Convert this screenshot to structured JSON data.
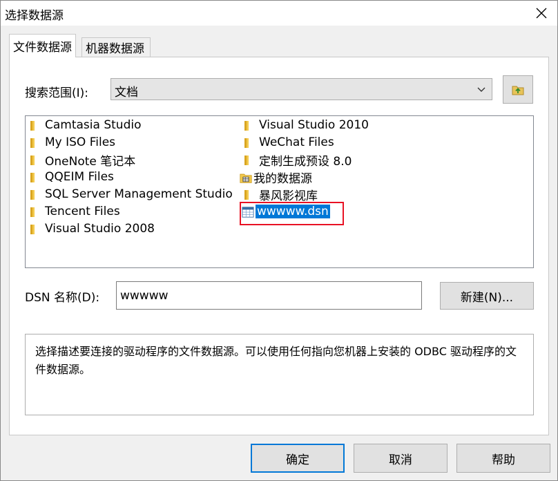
{
  "window": {
    "title": "选择数据源"
  },
  "tabs": [
    {
      "label": "文件数据源",
      "active": true
    },
    {
      "label": "机器数据源",
      "active": false
    }
  ],
  "look_in": {
    "label": "搜索范围(I):",
    "value": "文档"
  },
  "files": [
    {
      "name": "Camtasia Studio",
      "type": "folder"
    },
    {
      "name": "My ISO Files",
      "type": "folder"
    },
    {
      "name": "OneNote 笔记本",
      "type": "folder"
    },
    {
      "name": "QQEIM Files",
      "type": "folder"
    },
    {
      "name": "SQL Server Management Studio",
      "type": "folder"
    },
    {
      "name": "Tencent Files",
      "type": "folder"
    },
    {
      "name": "Visual Studio 2008",
      "type": "folder"
    },
    {
      "name": "Visual Studio 2010",
      "type": "folder"
    },
    {
      "name": "WeChat Files",
      "type": "folder"
    },
    {
      "name": "定制生成预设 8.0",
      "type": "folder"
    },
    {
      "name": "我的数据源",
      "type": "datasource-folder"
    },
    {
      "name": "暴风影视库",
      "type": "folder"
    },
    {
      "name": "wwwww.dsn",
      "type": "dsn-file",
      "selected": true
    }
  ],
  "dsn_name": {
    "label": "DSN 名称(D):",
    "value": "wwwww"
  },
  "buttons": {
    "new": "新建(N)...",
    "ok": "确定",
    "cancel": "取消",
    "help": "帮助"
  },
  "description": "选择描述要连接的驱动程序的文件数据源。可以使用任何指向您机器上安装的 ODBC 驱动程序的文件数据源。",
  "colors": {
    "selection": "#0078d7",
    "highlight_box": "#e81123",
    "folder": "#f2c94c"
  }
}
